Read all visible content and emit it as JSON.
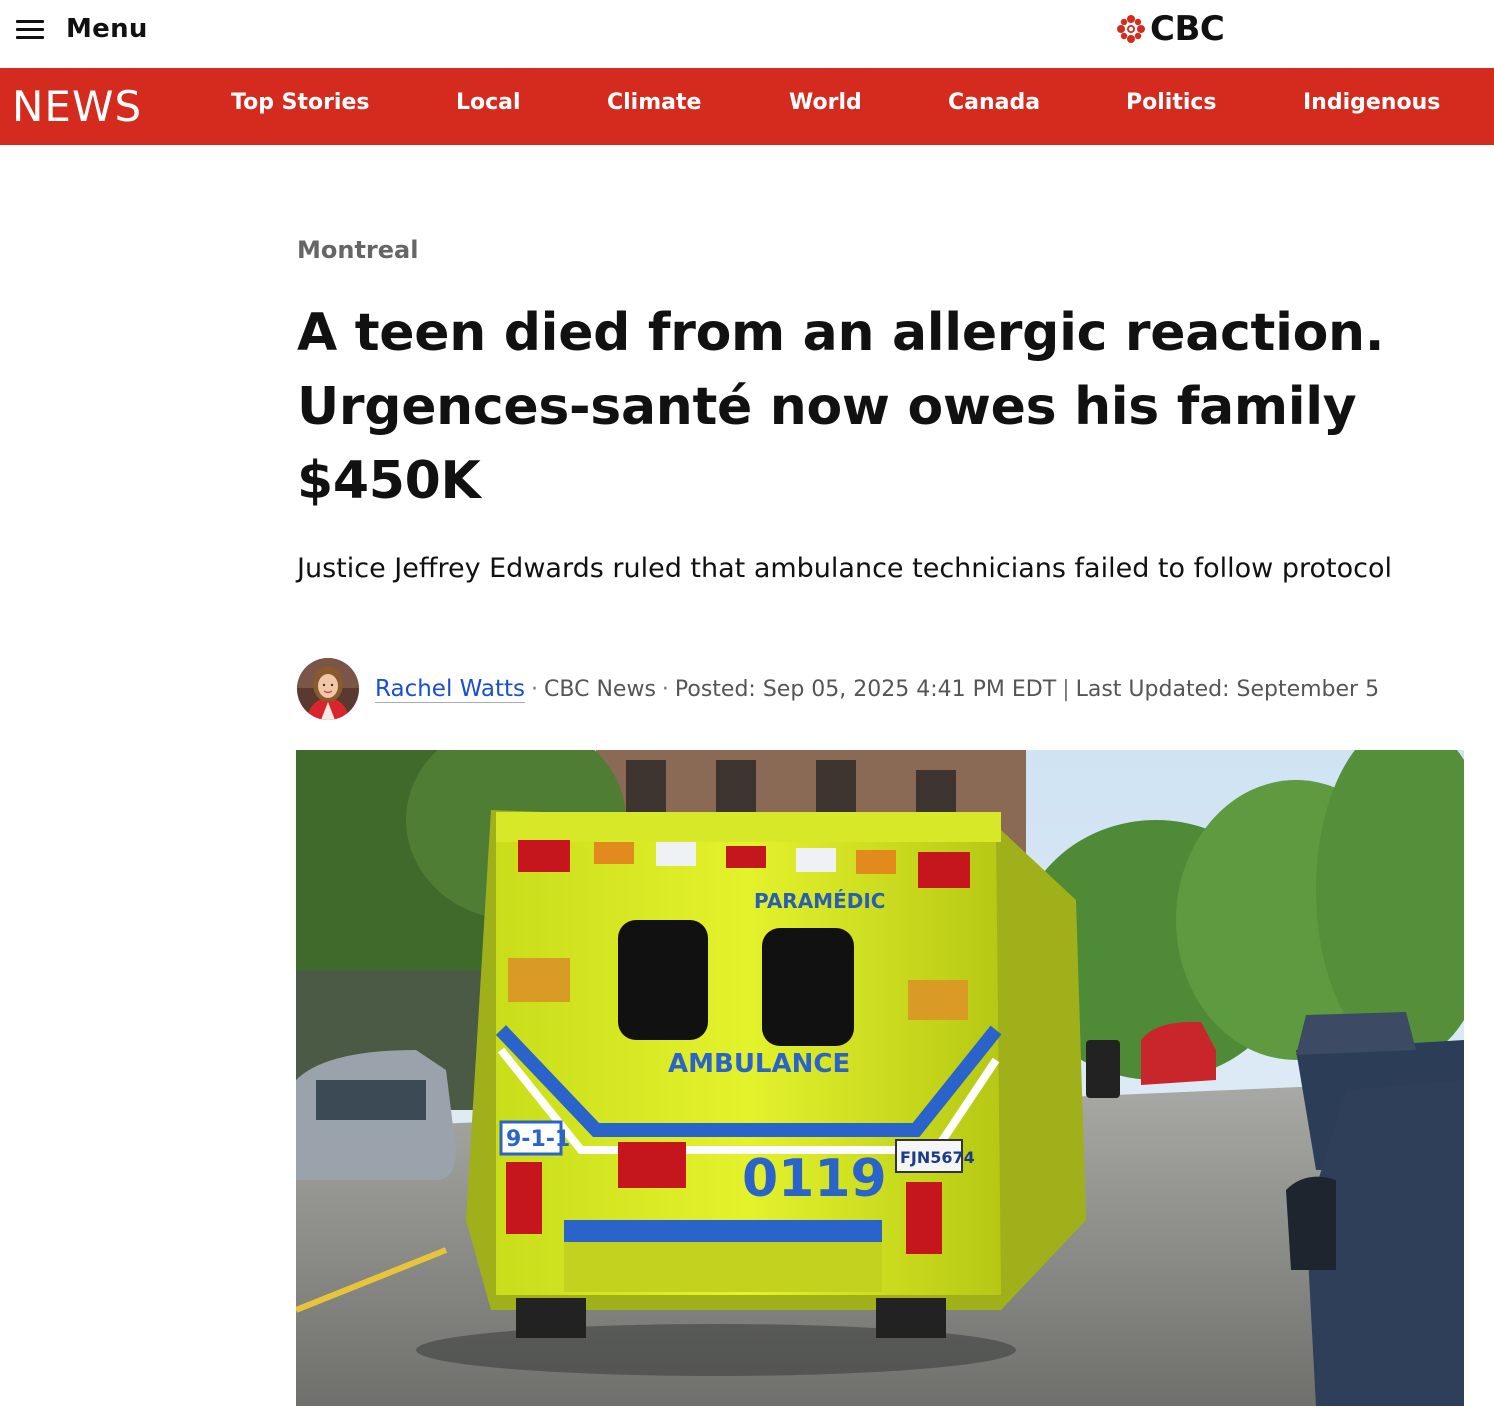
{
  "header": {
    "menu_label": "Menu",
    "logo_text": "CBC",
    "menu_icon": "hamburger-icon",
    "logo_icon": "cbc-gem-icon"
  },
  "nav": {
    "brand": "NEWS",
    "items": [
      "Top Stories",
      "Local",
      "Climate",
      "World",
      "Canada",
      "Politics",
      "Indigenous"
    ],
    "background": "#d52b1e"
  },
  "article": {
    "section": "Montreal",
    "headline_lines": [
      "A teen died from an allergic reaction.",
      "Urgences-santé now owes his family",
      "$450K"
    ],
    "dek": "Justice Jeffrey Edwards ruled that ambulance technicians failed to follow protocol",
    "byline": {
      "author": "Rachel Watts",
      "outlet": "CBC News",
      "posted": "Posted: Sep 05, 2025 4:41 PM EDT",
      "updated": "Last Updated: September 5"
    },
    "hero": {
      "ambulance_text": "PARAMÉDIC",
      "ambulance_label": "AMBULANCE",
      "unit_number": "0119",
      "emergency_number": "9-1-1",
      "plate": "FJN5674"
    }
  }
}
